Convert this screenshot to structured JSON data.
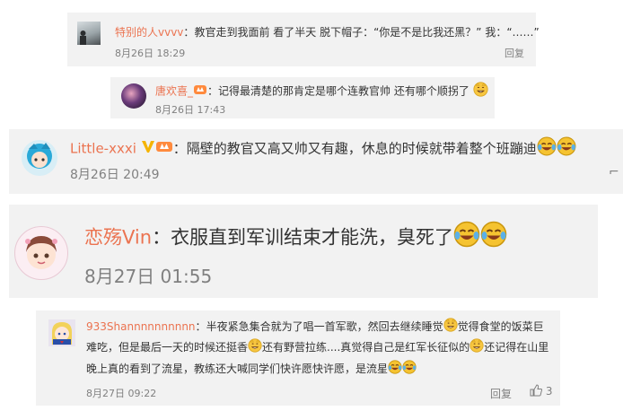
{
  "comments": [
    {
      "username": "特别的人vvvv",
      "separator": "：",
      "text": "教官走到我面前 看了半天 脱下帽子：“你是不是比我还黑？” 我：“……”",
      "timestamp": "8月26日 18:29",
      "reply_label": "回复"
    },
    {
      "username": "唐欢喜_",
      "separator": "：",
      "text": "记得最清楚的那肯定是哪个连教官帅 还有哪个顺拐了",
      "timestamp": "8月26日 17:43"
    },
    {
      "username": "Little-xxxi",
      "separator": "：",
      "text": "隔壁的教官又高又帅又有趣，休息的时候就带着整个班蹦迪",
      "timestamp": "8月26日 20:49"
    },
    {
      "username": "恋殇Vin",
      "separator": "：",
      "text": "衣服直到军训结束才能洗，臭死了",
      "timestamp": "8月27日 01:55"
    },
    {
      "username": "933Shannnnnnnnnn",
      "separator": "：",
      "line1_a": "半夜紧急集合就为了唱一首军歌，然回去继续睡觉",
      "line1_b": "觉得食堂的饭菜巨",
      "line2_a": "难吃，但是最后一天的时候还挺香",
      "line2_b": "还有野营拉练....真觉得自己是红军长征似的",
      "line2_c": "还记得在山里",
      "line3": "晚上真的看到了流星，教练还大喊同学们快许愿快许愿，是流星",
      "timestamp": "8月27日 09:22",
      "reply_label": "回复",
      "like_count": "3"
    }
  ],
  "colors": {
    "username": "#eb7350",
    "card_bg": "#f2f2f2",
    "meta": "#808080",
    "text": "#333333"
  },
  "icons": [
    "grin-emoji-icon",
    "laugh-cry-emoji-icon",
    "vip-badge-icon",
    "fan-badge-icon",
    "thumbs-up-icon"
  ]
}
